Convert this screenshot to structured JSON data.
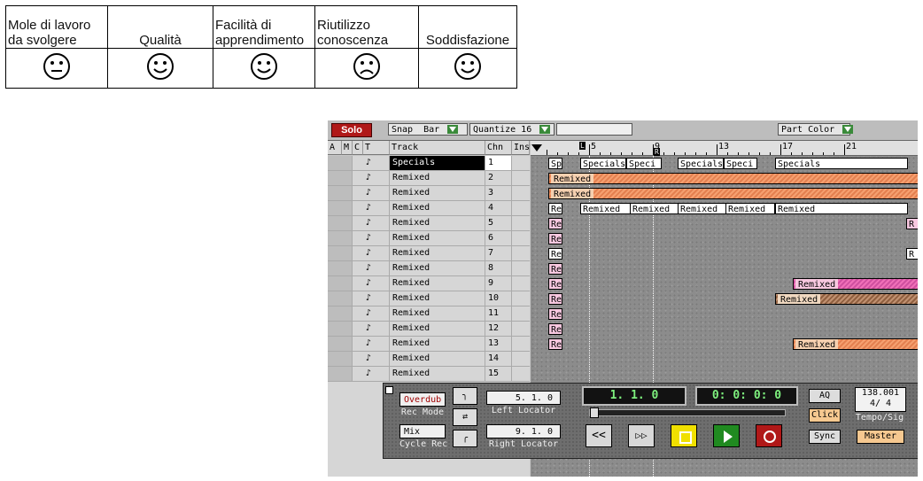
{
  "eval_table": {
    "headers": [
      "Mole di lavoro da svolgere",
      "Qualità",
      "Facilità di apprendimento",
      "Riutilizzo conoscenza",
      "Soddisfazione"
    ],
    "faces": [
      "neutral-face-icon",
      "smiley-face-icon",
      "smiley-face-icon",
      "sad-face-icon",
      "smiley-face-icon"
    ]
  },
  "toolbar": {
    "solo": "Solo",
    "snap_label": "Snap",
    "snap_value": "Bar",
    "quantize": "Quantize 16",
    "part_color": "Part Color"
  },
  "columns": {
    "a": "A",
    "m": "M",
    "c": "C",
    "t": "T",
    "track": "Track",
    "chn": "Chn",
    "inst": "Inst"
  },
  "tracks": [
    {
      "name": "Specials",
      "chn": "1"
    },
    {
      "name": "Remixed",
      "chn": "2"
    },
    {
      "name": "Remixed",
      "chn": "3"
    },
    {
      "name": "Remixed",
      "chn": "4"
    },
    {
      "name": "Remixed",
      "chn": "5"
    },
    {
      "name": "Remixed",
      "chn": "6"
    },
    {
      "name": "Remixed",
      "chn": "7"
    },
    {
      "name": "Remixed",
      "chn": "8"
    },
    {
      "name": "Remixed",
      "chn": "9"
    },
    {
      "name": "Remixed",
      "chn": "10"
    },
    {
      "name": "Remixed",
      "chn": "11"
    },
    {
      "name": "Remixed",
      "chn": "12"
    },
    {
      "name": "Remixed",
      "chn": "13"
    },
    {
      "name": "Remixed",
      "chn": "14"
    },
    {
      "name": "Remixed",
      "chn": "15"
    }
  ],
  "ruler": {
    "marks": [
      "5",
      "9",
      "13",
      "17",
      "21"
    ],
    "flag": "L",
    "flag2": "R"
  },
  "parts": {
    "specials": "Specials",
    "specials_short": "Speci",
    "sp": "Sp",
    "remixed": "Remixed",
    "re": "Re",
    "r": "R"
  },
  "transport": {
    "overdub": "Overdub",
    "rec_mode": "Rec Mode",
    "mix": "Mix",
    "cycle_rec": "Cycle Rec",
    "left_locator_value": "5. 1.   0",
    "left_locator": "Left Locator",
    "right_locator_value": "9. 1.   0",
    "right_locator": "Right Locator",
    "position": "1.  1.   0",
    "time": "0: 0: 0: 0",
    "aq": "AQ",
    "click": "Click",
    "sync": "Sync",
    "tempo": "138.001",
    "signature": "4/ 4",
    "tempo_sig": "Tempo/Sig",
    "master": "Master",
    "rewind": "<<",
    "forward": "▷▷"
  }
}
